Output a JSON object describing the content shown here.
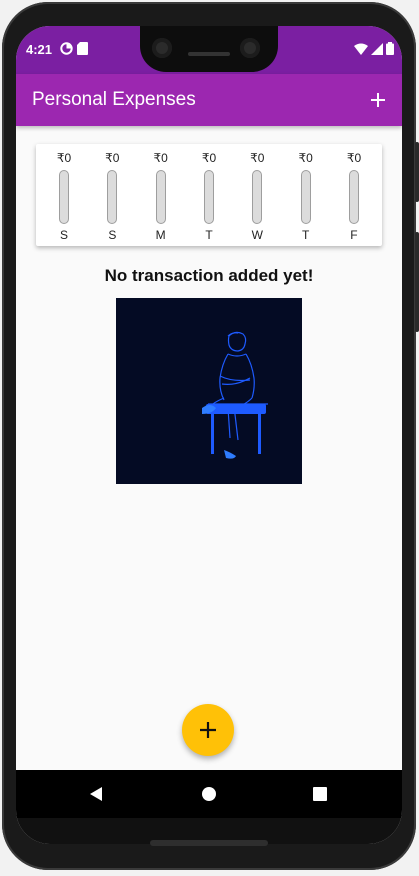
{
  "status_bar": {
    "time": "4:21",
    "left_icons": [
      "data-saver-icon",
      "sd-card-icon"
    ],
    "right_icons": [
      "wifi-icon",
      "signal-icon",
      "battery-icon"
    ]
  },
  "app_bar": {
    "title": "Personal Expenses",
    "add_icon": "plus-icon"
  },
  "chart": {
    "days": [
      {
        "label": "S",
        "amount": "₹0",
        "fraction": 0
      },
      {
        "label": "S",
        "amount": "₹0",
        "fraction": 0
      },
      {
        "label": "M",
        "amount": "₹0",
        "fraction": 0
      },
      {
        "label": "T",
        "amount": "₹0",
        "fraction": 0
      },
      {
        "label": "W",
        "amount": "₹0",
        "fraction": 0
      },
      {
        "label": "T",
        "amount": "₹0",
        "fraction": 0
      },
      {
        "label": "F",
        "amount": "₹0",
        "fraction": 0
      }
    ]
  },
  "empty_state": {
    "message": "No transaction added yet!",
    "illustration": "person-sitting-on-stool-illustration"
  },
  "fab": {
    "icon": "plus-icon"
  },
  "nav": {
    "back_icon": "back-triangle-icon",
    "home_icon": "home-circle-icon",
    "recents_icon": "recents-square-icon"
  },
  "colors": {
    "primary": "#9c27b0",
    "primary_dark": "#7b1fa2",
    "accent": "#ffc107",
    "illustration_bg": "#040b24",
    "illustration_line": "#1e5bff"
  }
}
